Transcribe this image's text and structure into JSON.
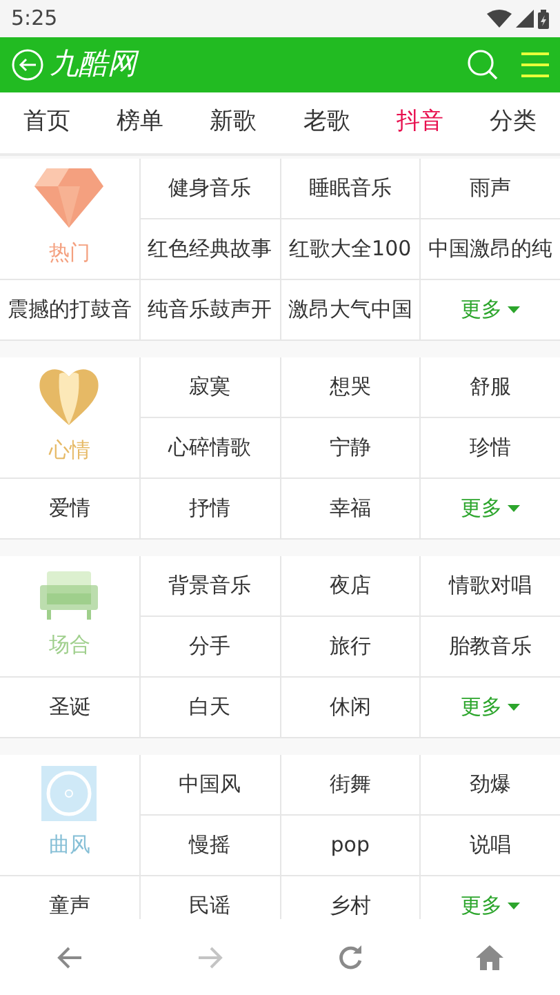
{
  "status_bar": {
    "time": "5:25"
  },
  "header": {
    "title": "九酷网"
  },
  "tabs": [
    {
      "label": "首页",
      "selected": false
    },
    {
      "label": "榜单",
      "selected": false
    },
    {
      "label": "新歌",
      "selected": false
    },
    {
      "label": "老歌",
      "selected": false
    },
    {
      "label": "抖音",
      "selected": true
    },
    {
      "label": "分类",
      "selected": false
    }
  ],
  "sections": [
    {
      "label": "热门",
      "kind": "diamond",
      "color": "#f4a07f",
      "items": [
        "健身音乐",
        "睡眠音乐",
        "雨声",
        "红色经典故事",
        "红歌大全100",
        "中国激昂的纯",
        "震撼的打鼓音",
        "纯音乐鼓声开",
        "激昂大气中国"
      ],
      "more": "更多"
    },
    {
      "label": "心情",
      "kind": "heart",
      "color": "#e6b965",
      "items": [
        "寂寞",
        "想哭",
        "舒服",
        "心碎情歌",
        "宁静",
        "珍惜",
        "爱情",
        "抒情",
        "幸福"
      ],
      "more": "更多"
    },
    {
      "label": "场合",
      "kind": "sofa",
      "color": "#9fcf8c",
      "items": [
        "背景音乐",
        "夜店",
        "情歌对唱",
        "分手",
        "旅行",
        "胎教音乐",
        "圣诞",
        "白天",
        "休闲"
      ],
      "more": "更多"
    },
    {
      "label": "曲风",
      "kind": "disc",
      "color": "#86bfd6",
      "items": [
        "中国风",
        "街舞",
        "劲爆",
        "慢摇",
        "pop",
        "说唱",
        "童声",
        "民谣",
        "乡村"
      ],
      "more": "更多"
    }
  ],
  "bottom_nav": [
    {
      "kind": "back",
      "disabled": false
    },
    {
      "kind": "forward",
      "disabled": true
    },
    {
      "kind": "reload",
      "disabled": false
    },
    {
      "kind": "home",
      "disabled": false
    }
  ]
}
